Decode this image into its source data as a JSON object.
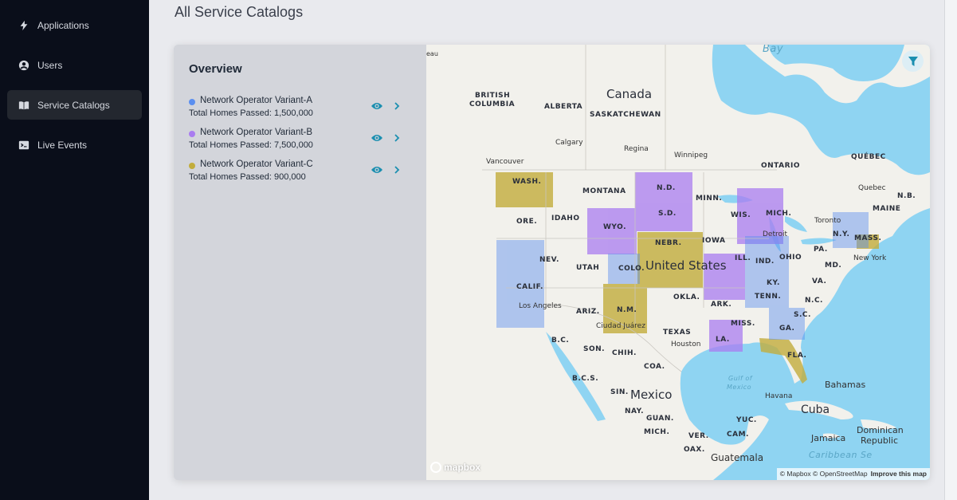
{
  "sidebar": {
    "items": [
      {
        "label": "Applications",
        "icon": "bolt-icon"
      },
      {
        "label": "Users",
        "icon": "user-icon"
      },
      {
        "label": "Service Catalogs",
        "icon": "book-icon",
        "active": true
      },
      {
        "label": "Live Events",
        "icon": "terminal-icon"
      }
    ]
  },
  "page": {
    "title": "All Service Catalogs"
  },
  "overview": {
    "title": "Overview",
    "variants": [
      {
        "name": "Network Operator Variant-A",
        "homes": "Total Homes Passed: 1,500,000",
        "color": "#5b8ff0"
      },
      {
        "name": "Network Operator Variant-B",
        "homes": "Total Homes Passed: 7,500,000",
        "color": "#a97cf0"
      },
      {
        "name": "Network Operator Variant-C",
        "homes": "Total Homes Passed: 900,000",
        "color": "#c2ad3c"
      }
    ]
  },
  "map": {
    "labels": {
      "canada": "Canada",
      "united_states": "United States",
      "mexico": "Mexico",
      "cuba": "Cuba",
      "bahamas": "Bahamas",
      "jamaica": "Jamaica",
      "dominican_republic_1": "Dominican",
      "dominican_republic_2": "Republic",
      "guatemala": "Guatemala",
      "bc_1": "BRITISH",
      "bc_2": "COLUMBIA",
      "alberta": "ALBERTA",
      "saskatchewan": "SASKATCHEWAN",
      "ontario": "ONTARIO",
      "quebec_prov": "QUÉBEC",
      "nb": "N.B.",
      "maine": "MAINE",
      "wash": "WASH.",
      "ore": "ORE.",
      "idaho": "IDAHO",
      "montana": "MONTANA",
      "nd": "N.D.",
      "sd": "S.D.",
      "minn": "MINN.",
      "wis": "WIS.",
      "mich": "MICH.",
      "wyo": "WYO.",
      "nebr": "NEBR.",
      "iowa": "IOWA",
      "ill": "ILL.",
      "ind": "IND.",
      "ohio": "OHIO",
      "pa": "PA.",
      "ny": "N.Y.",
      "mass": "MASS.",
      "md": "MD.",
      "nev": "NEV.",
      "utah": "UTAH",
      "colo": "COLO.",
      "calif": "CALIF.",
      "ky": "KY.",
      "va": "VA.",
      "okla": "OKLA.",
      "ark": "ARK.",
      "tenn": "TENN.",
      "nc": "N.C.",
      "sc": "S.C.",
      "ariz": "ARIZ.",
      "nm": "N.M.",
      "texas": "TEXAS",
      "miss": "MISS.",
      "ga": "GA.",
      "la": "LA.",
      "fla": "FLA.",
      "bc_mx": "B.C.",
      "son": "SON.",
      "chih": "CHIH.",
      "coa": "COA.",
      "bcs": "B.C.S.",
      "sin": "SIN.",
      "nay": "NAY.",
      "guan": "GUAN.",
      "mich_mx": "MICH.",
      "ver": "VER.",
      "oax": "OAX.",
      "yuc": "YUC.",
      "cam": "CAM.",
      "vancouver": "Vancouver",
      "calgary": "Calgary",
      "regina": "Regina",
      "winnipeg": "Winnipeg",
      "toronto": "Toronto",
      "detroit": "Detroit",
      "quebec_city": "Quebec",
      "new_york": "New York",
      "los_angeles": "Los Angeles",
      "ciudad_juarez": "Ciudad Juárez",
      "houston": "Houston",
      "havana": "Havana",
      "gulf_1": "Gulf of",
      "gulf_2": "Mexico",
      "bay": "Bay",
      "caribbean": "Caribbean Se",
      "eau": "eau"
    },
    "mapbox_logo": "mapbox",
    "attribution_1": "© Mapbox © OpenStreetMap",
    "attribution_2": "Improve this map"
  }
}
